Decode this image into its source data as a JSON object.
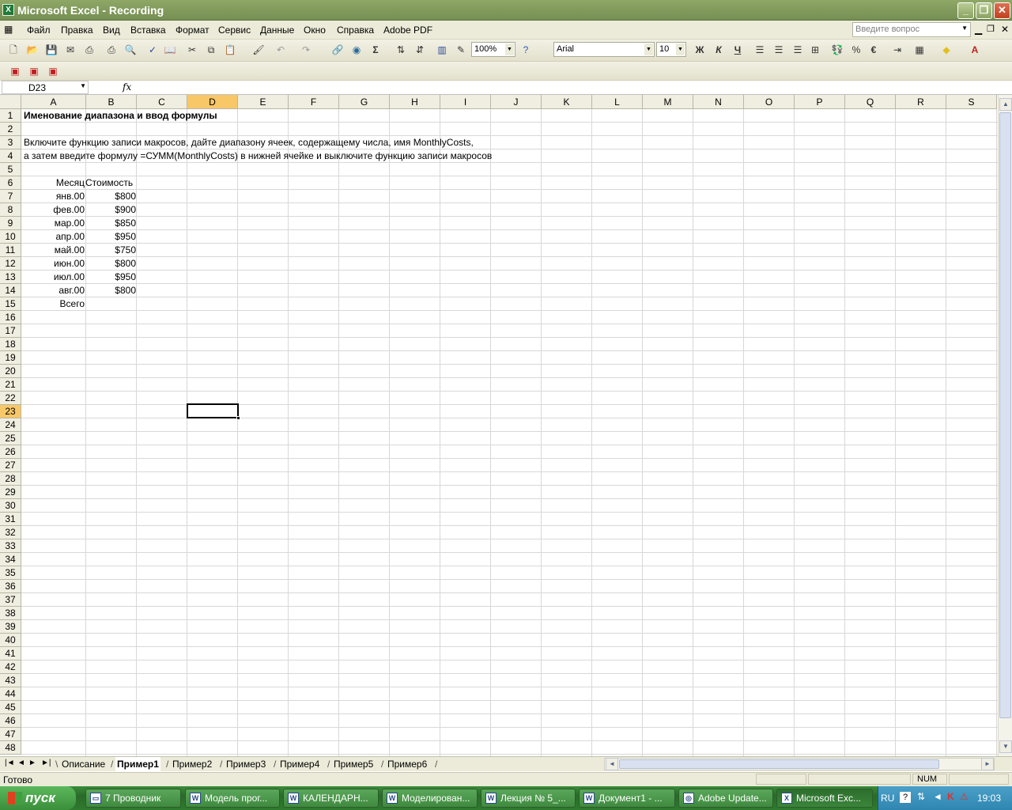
{
  "window": {
    "title": "Microsoft Excel - Recording"
  },
  "menu": [
    "Файл",
    "Правка",
    "Вид",
    "Вставка",
    "Формат",
    "Сервис",
    "Данные",
    "Окно",
    "Справка",
    "Adobe PDF"
  ],
  "help_placeholder": "Введите вопрос",
  "toolbar": {
    "zoom": "100%",
    "font": "Arial",
    "size": "10",
    "bold": "Ж",
    "italic": "К",
    "underline": "Ч"
  },
  "formula_bar": {
    "cell_ref": "D23",
    "fx": "fx",
    "value": ""
  },
  "columns": [
    "A",
    "B",
    "C",
    "D",
    "E",
    "F",
    "G",
    "H",
    "I",
    "J",
    "K",
    "L",
    "M",
    "N",
    "O",
    "P",
    "Q",
    "R",
    "S"
  ],
  "selected_column": "D",
  "selected_row": 23,
  "sheet": {
    "title": "Именование диапазона и ввод формулы",
    "line3": "Включите функцию записи макросов, дайте  диапазону ячеек, содержащему числа, имя MonthlyCosts,",
    "line4": "а затем введите формулу  =СУММ(MonthlyCosts) в нижней ячейке и выключите функцию записи макросов",
    "hdr_month": "Месяц",
    "hdr_cost": "Стоимость",
    "rows": [
      {
        "month": "янв.00",
        "cost": "$800"
      },
      {
        "month": "фев.00",
        "cost": "$900"
      },
      {
        "month": "мар.00",
        "cost": "$850"
      },
      {
        "month": "апр.00",
        "cost": "$950"
      },
      {
        "month": "май.00",
        "cost": "$750"
      },
      {
        "month": "июн.00",
        "cost": "$800"
      },
      {
        "month": "июл.00",
        "cost": "$950"
      },
      {
        "month": "авг.00",
        "cost": "$800"
      }
    ],
    "total_label": "Всего"
  },
  "sheet_tabs": [
    "Описание",
    "Пример1",
    "Пример2",
    "Пример3",
    "Пример4",
    "Пример5",
    "Пример6"
  ],
  "active_tab": "Пример1",
  "status": {
    "text": "Готово",
    "num": "NUM"
  },
  "taskbar": {
    "start": "пуск",
    "tasks": [
      {
        "label": "7 Проводник",
        "icon": "folder-icon"
      },
      {
        "label": "Модель прог...",
        "icon": "word-icon"
      },
      {
        "label": "КАЛЕНДАРН...",
        "icon": "word-icon"
      },
      {
        "label": "Моделирован...",
        "icon": "word-icon"
      },
      {
        "label": "Лекция № 5_...",
        "icon": "word-icon"
      },
      {
        "label": "Документ1 - ...",
        "icon": "word-icon"
      },
      {
        "label": "Adobe Update...",
        "icon": "adobe-icon"
      },
      {
        "label": "Microsoft Exc...",
        "icon": "excel-icon"
      }
    ],
    "lang": "RU",
    "clock": "19:03"
  }
}
